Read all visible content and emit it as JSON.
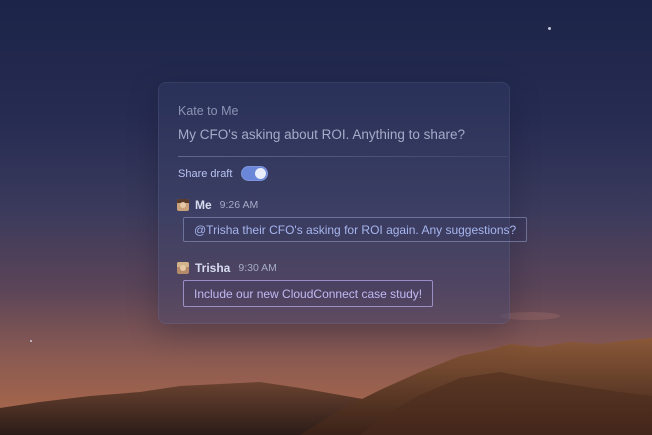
{
  "thread": {
    "header": "Kate to Me",
    "subject": "My CFO's asking about ROI. Anything to share?"
  },
  "share_draft": {
    "label": "Share draft",
    "enabled": true
  },
  "messages": [
    {
      "sender": "Me",
      "time": "9:26 AM",
      "text": "@Trisha their CFO's asking for ROI again. Any suggestions?",
      "avatar": "person-photo"
    },
    {
      "sender": "Trisha",
      "time": "9:30 AM",
      "text": "Include our new CloudConnect case study!",
      "avatar": "person-photo"
    }
  ],
  "colors": {
    "accent": "#6a86d8",
    "bubble_text": "#a6b6ef"
  }
}
